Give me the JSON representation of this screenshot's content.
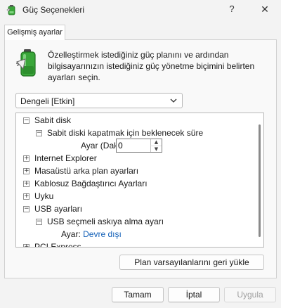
{
  "window": {
    "title": "Güç Seçenekleri",
    "help_label": "?",
    "close_label": "✕",
    "icon": "power-options-icon"
  },
  "tab": {
    "label": "Gelişmiş ayarlar"
  },
  "description": "Özelleştirmek istediğiniz güç planını ve ardından bilgisayarınızın istediğiniz güç yönetme biçimini belirten ayarları seçin.",
  "plan_select": {
    "value": "Dengeli [Etkin]",
    "icon": "chevron-down-icon"
  },
  "tree": {
    "hdd": {
      "label": "Sabit disk",
      "expander": "−"
    },
    "hdd_off": {
      "label": "Sabit diski kapatmak için beklenecek süre",
      "expander": "−"
    },
    "hdd_setting": {
      "label": "Ayar (Dakika):",
      "value": "0",
      "up": "▲",
      "down": "▼"
    },
    "ie": {
      "label": "Internet Explorer",
      "expander": "+"
    },
    "desktop_bg": {
      "label": "Masaüstü arka plan ayarları",
      "expander": "+"
    },
    "wireless": {
      "label": "Kablosuz Bağdaştırıcı Ayarları",
      "expander": "+"
    },
    "sleep": {
      "label": "Uyku",
      "expander": "+"
    },
    "usb": {
      "label": "USB ayarları",
      "expander": "−"
    },
    "usb_suspend": {
      "label": "USB seçmeli askıya alma ayarı",
      "expander": "−"
    },
    "usb_setting": {
      "label": "Ayar:",
      "value": "Devre dışı"
    },
    "pci": {
      "label": "PCI Express",
      "expander": "+"
    }
  },
  "buttons": {
    "restore_defaults": "Plan varsayılanlarını geri yükle",
    "ok": "Tamam",
    "cancel": "İptal",
    "apply": "Uygula"
  },
  "colors": {
    "link": "#1461b8",
    "battery_green": "#3aa63a"
  }
}
